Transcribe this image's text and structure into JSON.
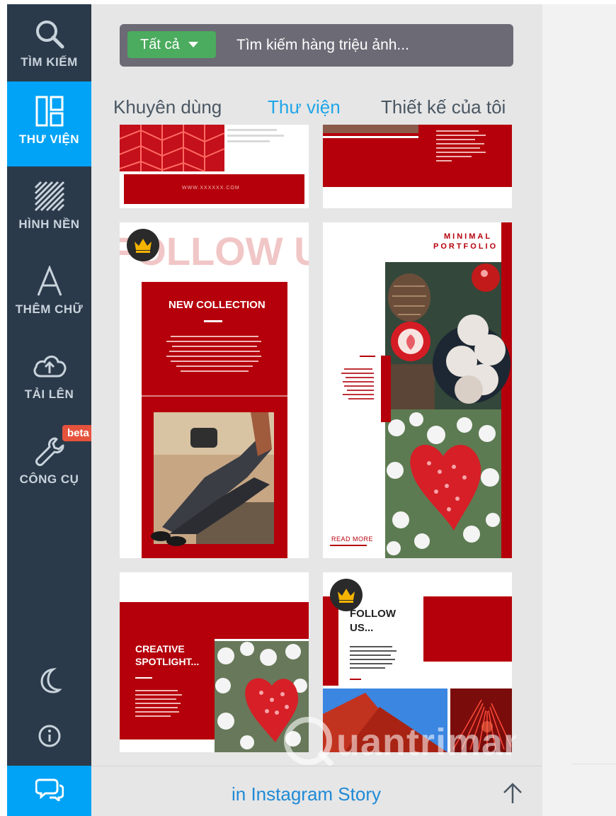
{
  "sidebar": {
    "items": [
      {
        "label": "TÌM KIẾM",
        "icon": "search-icon"
      },
      {
        "label": "THƯ VIỆN",
        "icon": "library-icon"
      },
      {
        "label": "HÌNH NỀN",
        "icon": "background-icon"
      },
      {
        "label": "THÊM CHỮ",
        "icon": "text-icon"
      },
      {
        "label": "TẢI LÊN",
        "icon": "upload-icon"
      },
      {
        "label": "CÔNG CỤ",
        "icon": "wrench-icon"
      }
    ],
    "beta_badge": "beta",
    "bottom_icons": [
      "moon-icon",
      "info-icon",
      "chat-icon"
    ]
  },
  "search": {
    "filter_label": "Tất cả",
    "placeholder": "Tìm kiếm hàng triệu ảnh..."
  },
  "tabs": [
    {
      "label": "Khuyên dùng",
      "active": false
    },
    {
      "label": "Thư viện",
      "active": true
    },
    {
      "label": "Thiết kế của tôi",
      "active": false
    }
  ],
  "templates": {
    "card1_url": "WWW.XXXXXX.COM",
    "card3_heading": "FOLLOW US",
    "card3_title": "NEW COLLECTION",
    "card4_title_line1": "MINIMAL",
    "card4_title_line2": "PORTFOLIO",
    "card4_read_more": "READ MORE",
    "card5_title_line1": "CREATIVE",
    "card5_title_line2": "SPOTLIGHT...",
    "card6_title_line1": "FOLLOW",
    "card6_title_line2": "US..."
  },
  "bottom_bar": {
    "link_label": "in Instagram Story",
    "icon": "arrow-up-icon"
  },
  "watermark": "Quantrimang",
  "colors": {
    "sidebar_bg": "#2b3a4a",
    "accent_blue": "#00a3f5",
    "template_red": "#b5000b",
    "filter_green": "#4bab5e"
  }
}
